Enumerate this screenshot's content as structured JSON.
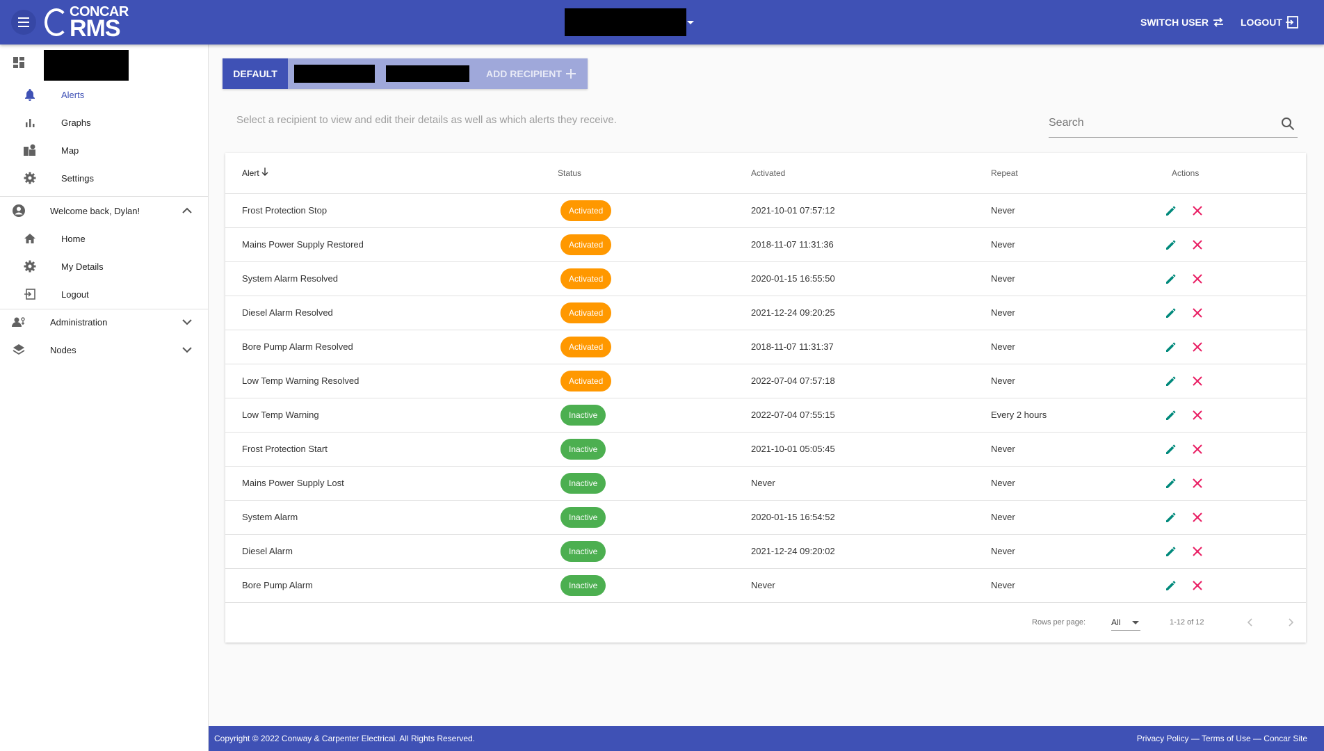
{
  "header": {
    "logo_top": "CONCAR",
    "logo_bottom": "RMS",
    "switch_user": "SWITCH USER",
    "logout": "LOGOUT"
  },
  "sidebar": {
    "alerts": "Alerts",
    "graphs": "Graphs",
    "map": "Map",
    "settings": "Settings",
    "welcome": "Welcome back, Dylan!",
    "home": "Home",
    "my_details": "My Details",
    "logout": "Logout",
    "administration": "Administration",
    "nodes": "Nodes"
  },
  "tabs": {
    "default": "DEFAULT",
    "add_recipient": "ADD RECIPIENT"
  },
  "hint": "Select a recipient to view and edit their details as well as which alerts they receive.",
  "search": {
    "placeholder": "Search"
  },
  "table": {
    "columns": {
      "alert": "Alert",
      "status": "Status",
      "activated": "Activated",
      "repeat": "Repeat",
      "actions": "Actions"
    },
    "rows": [
      {
        "alert": "Frost Protection Stop",
        "status": "Activated",
        "activated": "2021-10-01 07:57:12",
        "repeat": "Never"
      },
      {
        "alert": "Mains Power Supply Restored",
        "status": "Activated",
        "activated": "2018-11-07 11:31:36",
        "repeat": "Never"
      },
      {
        "alert": "System Alarm Resolved",
        "status": "Activated",
        "activated": "2020-01-15 16:55:50",
        "repeat": "Never"
      },
      {
        "alert": "Diesel Alarm Resolved",
        "status": "Activated",
        "activated": "2021-12-24 09:20:25",
        "repeat": "Never"
      },
      {
        "alert": "Bore Pump Alarm Resolved",
        "status": "Activated",
        "activated": "2018-11-07 11:31:37",
        "repeat": "Never"
      },
      {
        "alert": "Low Temp Warning Resolved",
        "status": "Activated",
        "activated": "2022-07-04 07:57:18",
        "repeat": "Never"
      },
      {
        "alert": "Low Temp Warning",
        "status": "Inactive",
        "activated": "2022-07-04 07:55:15",
        "repeat": "Every 2 hours"
      },
      {
        "alert": "Frost Protection Start",
        "status": "Inactive",
        "activated": "2021-10-01 05:05:45",
        "repeat": "Never"
      },
      {
        "alert": "Mains Power Supply Lost",
        "status": "Inactive",
        "activated": "Never",
        "repeat": "Never"
      },
      {
        "alert": "System Alarm",
        "status": "Inactive",
        "activated": "2020-01-15 16:54:52",
        "repeat": "Never"
      },
      {
        "alert": "Diesel Alarm",
        "status": "Inactive",
        "activated": "2021-12-24 09:20:02",
        "repeat": "Never"
      },
      {
        "alert": "Bore Pump Alarm",
        "status": "Inactive",
        "activated": "Never",
        "repeat": "Never"
      }
    ]
  },
  "pagination": {
    "rows_per_page_label": "Rows per page:",
    "rows_per_page_value": "All",
    "range": "1-12 of 12"
  },
  "footer": {
    "copyright": "Copyright © 2022 Conway & Carpenter Electrical. All Rights Reserved.",
    "privacy": "Privacy Policy",
    "terms": "Terms of Use",
    "site": "Concar Site",
    "separator": " — "
  },
  "colors": {
    "primary": "#3f51b5",
    "activated": "#ff9800",
    "inactive": "#4caf50",
    "edit": "#00897b",
    "delete": "#e91e63"
  }
}
